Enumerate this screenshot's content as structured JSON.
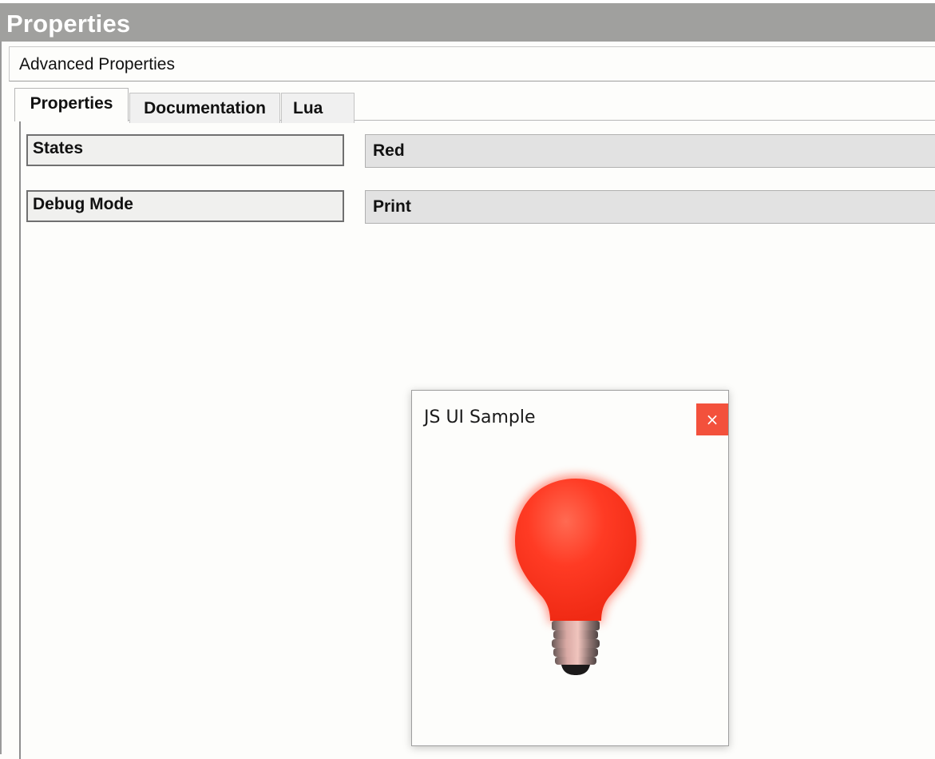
{
  "window": {
    "title": "Properties"
  },
  "group": {
    "label": "Advanced Properties"
  },
  "tabs": [
    {
      "label": "Properties",
      "active": true
    },
    {
      "label": "Documentation",
      "active": false
    },
    {
      "label": "Lua",
      "active": false
    }
  ],
  "properties": [
    {
      "name": "States",
      "value": "Red"
    },
    {
      "name": "Debug Mode",
      "value": "Print"
    }
  ],
  "dialog": {
    "title": "JS UI Sample",
    "close_label": "×",
    "bulb_state": "Red",
    "bulb_icon": "light-bulb-icon"
  },
  "colors": {
    "title_bar": "#a0a09e",
    "close_button": "#f3513c",
    "bulb": "#ff3a24"
  }
}
